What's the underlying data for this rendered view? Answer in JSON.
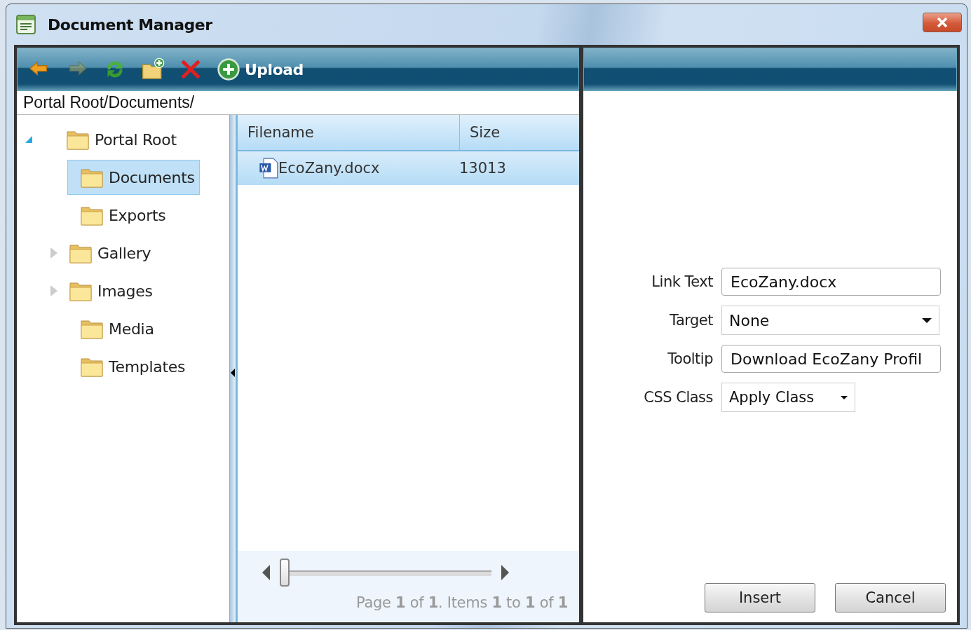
{
  "window": {
    "title": "Document Manager"
  },
  "toolbar": {
    "buttons": [
      {
        "kind": "back",
        "disabled": false
      },
      {
        "kind": "forward",
        "disabled": true
      },
      {
        "kind": "refresh",
        "disabled": false
      },
      {
        "kind": "new-folder",
        "disabled": false
      },
      {
        "kind": "delete",
        "disabled": false
      },
      {
        "kind": "upload",
        "disabled": false,
        "label": "Upload"
      }
    ]
  },
  "path": "Portal Root/Documents/",
  "tree": {
    "items": [
      {
        "label": "Portal Root",
        "kind": "expandable",
        "expanded": true,
        "selected": false,
        "children": [
          {
            "label": "Documents",
            "kind": "leaf",
            "selected": true
          },
          {
            "label": "Exports",
            "kind": "leaf",
            "selected": false
          },
          {
            "label": "Gallery",
            "kind": "expandable",
            "expanded": false,
            "selected": false
          },
          {
            "label": "Images",
            "kind": "expandable",
            "expanded": false,
            "selected": false
          },
          {
            "label": "Media",
            "kind": "leaf",
            "selected": false
          },
          {
            "label": "Templates",
            "kind": "leaf",
            "selected": false
          }
        ]
      }
    ]
  },
  "grid": {
    "columns": [
      "Filename",
      "Size"
    ],
    "rows": [
      {
        "filename": "EcoZany.docx",
        "size": "13013",
        "selected": true
      }
    ]
  },
  "pager": {
    "level": 0,
    "text": "Page **1** of **1**. Items **1** to **1** of **1**"
  },
  "form": {
    "fields": [
      {
        "kind": "text",
        "label": "Link Text",
        "value": "EcoZany.docx"
      },
      {
        "kind": "select",
        "label": "Target",
        "value": "None"
      },
      {
        "kind": "text",
        "label": "Tooltip",
        "value": "Download EcoZany Profil"
      },
      {
        "kind": "small-select",
        "label": "CSS Class",
        "value": "Apply Class"
      }
    ]
  },
  "buttons": [
    "Insert",
    "Cancel"
  ]
}
